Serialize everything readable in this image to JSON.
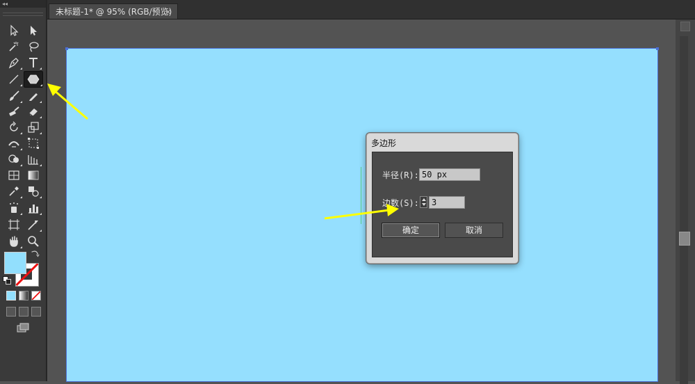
{
  "app": {
    "document_tab": {
      "title": "未标题-1* @ 95% (RGB/预览)",
      "close_glyph": "×"
    },
    "panel_collapse_glyph": "◂◂"
  },
  "toolbar": {
    "tools": [
      "selection-tool",
      "direct-selection-tool",
      "magic-wand-tool",
      "lasso-tool",
      "pen-tool",
      "type-tool",
      "line-segment-tool",
      "polygon-tool",
      "paintbrush-tool",
      "pencil-tool",
      "blob-brush-tool",
      "eraser-tool",
      "rotate-tool",
      "scale-tool",
      "width-tool",
      "free-transform-tool",
      "shape-builder-tool",
      "perspective-grid-tool",
      "mesh-tool",
      "gradient-tool",
      "eyedropper-tool",
      "blend-tool",
      "symbol-sprayer-tool",
      "column-graph-tool",
      "artboard-tool",
      "slice-tool",
      "hand-tool",
      "zoom-tool"
    ],
    "active_tool": "polygon-tool",
    "fill_color": "#92dffd",
    "stroke_color": "none"
  },
  "canvas": {
    "artboard_color": "#95dffe"
  },
  "dialog": {
    "title": "多边形",
    "radius_label": "半径(R):",
    "radius_value": "50 px",
    "sides_label": "边数(S):",
    "sides_value": "3",
    "ok_label": "确定",
    "cancel_label": "取消"
  },
  "annotations": {
    "arrow_color": "#ffff00"
  }
}
